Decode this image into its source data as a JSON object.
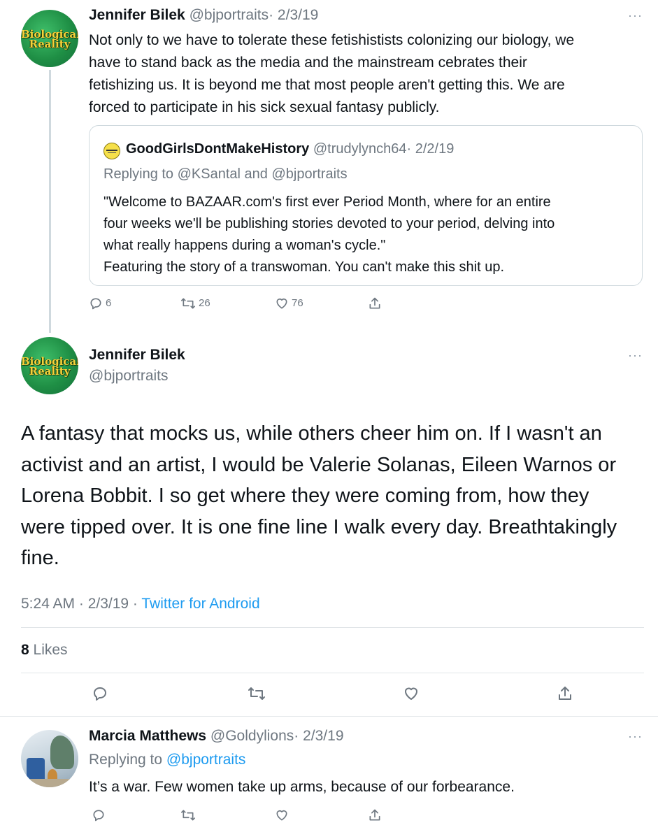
{
  "tweet1": {
    "author_name": "Jennifer Bilek",
    "author_handle": "@bjportraits",
    "date": "· 2/3/19",
    "avatar_text_line1": "Biological",
    "avatar_text_line2": "Reality",
    "text_lines": [
      "Not only to we have to tolerate these fetishistists colonizing our biology, we",
      "have to stand back as the media and the mainstream cebrates their",
      "fetishizing us. It is beyond me that most people aren't getting this. We are",
      "forced to participate in his sick sexual fantasy publicly."
    ],
    "quote": {
      "author_name": "GoodGirlsDontMakeHistory",
      "author_handle": "@trudylynch64",
      "date": "· 2/2/19",
      "replying_prefix": "Replying to ",
      "replying_to": "@KSantal and @bjportraits",
      "text_lines": [
        "\"Welcome to BAZAAR.com's first ever Period Month, where for an entire",
        "four weeks we'll be publishing stories devoted to your period, delving into",
        "what really happens during a woman's cycle.\"",
        "Featuring the story of a transwoman. You can't make this shit up."
      ]
    },
    "actions": {
      "replies": "6",
      "retweets": "26",
      "likes": "76"
    }
  },
  "main_tweet": {
    "author_name": "Jennifer Bilek",
    "author_handle": "@bjportraits",
    "avatar_text_line1": "Biological",
    "avatar_text_line2": "Reality",
    "text_lines": [
      "A fantasy that mocks us, while others cheer him on. If I wasn't an",
      "activist and an artist, I would be Valerie Solanas, Eileen Warnos or",
      "Lorena Bobbit. I so get where they were coming from, how they",
      "were tipped over.  It is one fine line I walk every day. Breathtakingly",
      "fine."
    ],
    "time": "5:24 AM · 2/3/19 · ",
    "source": "Twitter for Android",
    "likes_count": "8",
    "likes_label": " Likes"
  },
  "reply": {
    "author_name": "Marcia Matthews",
    "author_handle": "@Goldylions",
    "date": "· 2/3/19",
    "replying_prefix": "Replying to ",
    "replying_to": "@bjportraits",
    "text": "It’s a war. Few women take up arms, because of our forbearance."
  },
  "more_glyph": "···",
  "colors": {
    "link": "#1d9bf0",
    "muted": "#6e7780",
    "logo_green": "#1f8f45",
    "logo_text": "#f4d23a"
  }
}
